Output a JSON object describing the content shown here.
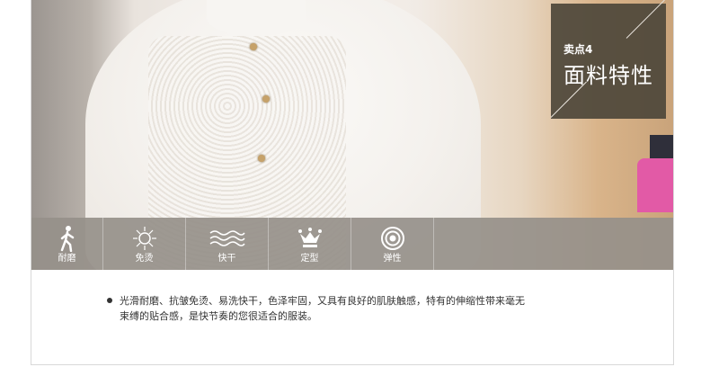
{
  "badge": {
    "sub": "卖点4",
    "title": "面料特性"
  },
  "icons": [
    {
      "name": "walking-person-icon",
      "label": "耐磨"
    },
    {
      "name": "sun-burst-icon",
      "label": "免烫"
    },
    {
      "name": "water-waves-icon",
      "label": "快干"
    },
    {
      "name": "crown-icon",
      "label": "定型"
    },
    {
      "name": "target-rings-icon",
      "label": "弹性"
    }
  ],
  "description": {
    "line1": "光滑耐磨、抗皱免烫、易洗快干，色泽牢固，又具有良好的肌肤触感，特有的伸缩性带来毫无",
    "line2": "束缚的贴合感，是快节奏的您很适合的服装。"
  },
  "colors": {
    "badge_bg": "#4d463a",
    "icon_bar": "#96908a",
    "pink_accent": "#e25aa6"
  }
}
